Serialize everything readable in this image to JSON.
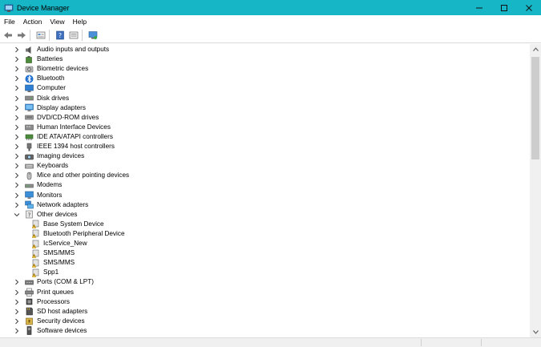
{
  "window": {
    "title": "Device Manager",
    "accent": "#17b6c6",
    "controls": [
      "minimize-icon",
      "maximize-icon",
      "close-icon"
    ]
  },
  "menu": [
    "File",
    "Action",
    "View",
    "Help"
  ],
  "toolbar": {
    "buttons": [
      "back-arrow-icon",
      "forward-arrow-icon",
      "properties-icon",
      "help-icon",
      "show-hidden-icon",
      "monitor-scan-icon"
    ]
  },
  "tree": {
    "categories": [
      {
        "label": "Audio inputs and outputs",
        "icon": "speaker-icon",
        "expanded": false
      },
      {
        "label": "Batteries",
        "icon": "battery-icon",
        "expanded": false
      },
      {
        "label": "Biometric devices",
        "icon": "biometric-icon",
        "expanded": false
      },
      {
        "label": "Bluetooth",
        "icon": "bluetooth-icon",
        "expanded": false
      },
      {
        "label": "Computer",
        "icon": "computer-icon",
        "expanded": false
      },
      {
        "label": "Disk drives",
        "icon": "disk-icon",
        "expanded": false
      },
      {
        "label": "Display adapters",
        "icon": "display-icon",
        "expanded": false
      },
      {
        "label": "DVD/CD-ROM drives",
        "icon": "dvd-icon",
        "expanded": false
      },
      {
        "label": "Human Interface Devices",
        "icon": "hid-icon",
        "expanded": false
      },
      {
        "label": "IDE ATA/ATAPI controllers",
        "icon": "ide-icon",
        "expanded": false
      },
      {
        "label": "IEEE 1394 host controllers",
        "icon": "firewire-icon",
        "expanded": false
      },
      {
        "label": "Imaging devices",
        "icon": "camera-icon",
        "expanded": false
      },
      {
        "label": "Keyboards",
        "icon": "keyboard-icon",
        "expanded": false
      },
      {
        "label": "Mice and other pointing devices",
        "icon": "mouse-icon",
        "expanded": false
      },
      {
        "label": "Modems",
        "icon": "modem-icon",
        "expanded": false
      },
      {
        "label": "Monitors",
        "icon": "monitor-icon",
        "expanded": false
      },
      {
        "label": "Network adapters",
        "icon": "network-icon",
        "expanded": false
      },
      {
        "label": "Other devices",
        "icon": "unknown-device-icon",
        "expanded": true,
        "children": [
          {
            "label": "Base System Device",
            "icon": "warning-device-icon"
          },
          {
            "label": "Bluetooth Peripheral Device",
            "icon": "warning-device-icon"
          },
          {
            "label": "IcService_New",
            "icon": "warning-device-icon"
          },
          {
            "label": "SMS/MMS",
            "icon": "warning-device-icon"
          },
          {
            "label": "SMS/MMS",
            "icon": "warning-device-icon"
          },
          {
            "label": "Spp1",
            "icon": "warning-device-icon"
          }
        ]
      },
      {
        "label": "Ports (COM & LPT)",
        "icon": "port-icon",
        "expanded": false
      },
      {
        "label": "Print queues",
        "icon": "printer-icon",
        "expanded": false
      },
      {
        "label": "Processors",
        "icon": "processor-icon",
        "expanded": false
      },
      {
        "label": "SD host adapters",
        "icon": "sd-card-icon",
        "expanded": false
      },
      {
        "label": "Security devices",
        "icon": "security-icon",
        "expanded": false
      },
      {
        "label": "Software devices",
        "icon": "software-device-icon",
        "expanded": false
      }
    ]
  }
}
